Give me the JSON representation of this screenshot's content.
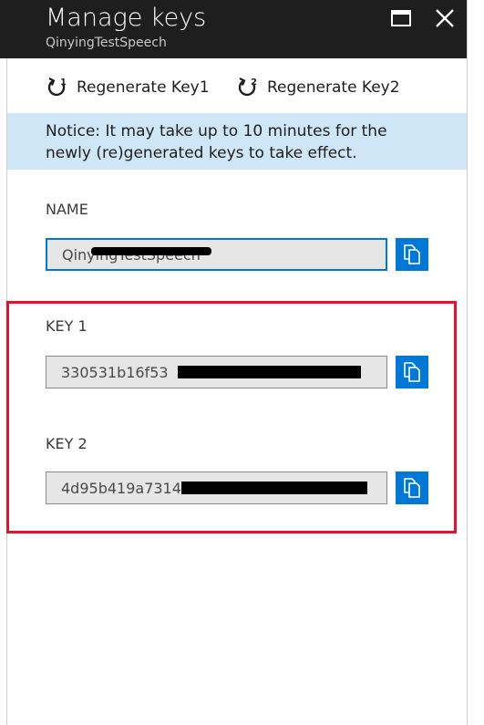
{
  "header": {
    "title": "Manage keys",
    "subtitle": "QinyingTestSpeech",
    "maximize_icon": "maximize-icon",
    "close_icon": "close-icon"
  },
  "toolbar": {
    "regen_key1_label": "Regenerate Key1",
    "regen_key2_label": "Regenerate Key2",
    "regen_key1_icon": "refresh-1-icon",
    "regen_key2_icon": "refresh-2-icon"
  },
  "notice": {
    "text": "Notice: It may take up to 10 minutes for the newly (re)generated keys to take effect."
  },
  "fields": {
    "name": {
      "label": "NAME",
      "value": "QinyingTestSpeech"
    },
    "key1": {
      "label": "KEY 1",
      "value": "330531b16f53"
    },
    "key2": {
      "label": "KEY 2",
      "value": "4d95b419a7314"
    }
  },
  "colors": {
    "header_bg": "#1e1e1e",
    "notice_bg": "#cfe6f7",
    "accent": "#0078d7",
    "highlight": "#e8112d"
  }
}
